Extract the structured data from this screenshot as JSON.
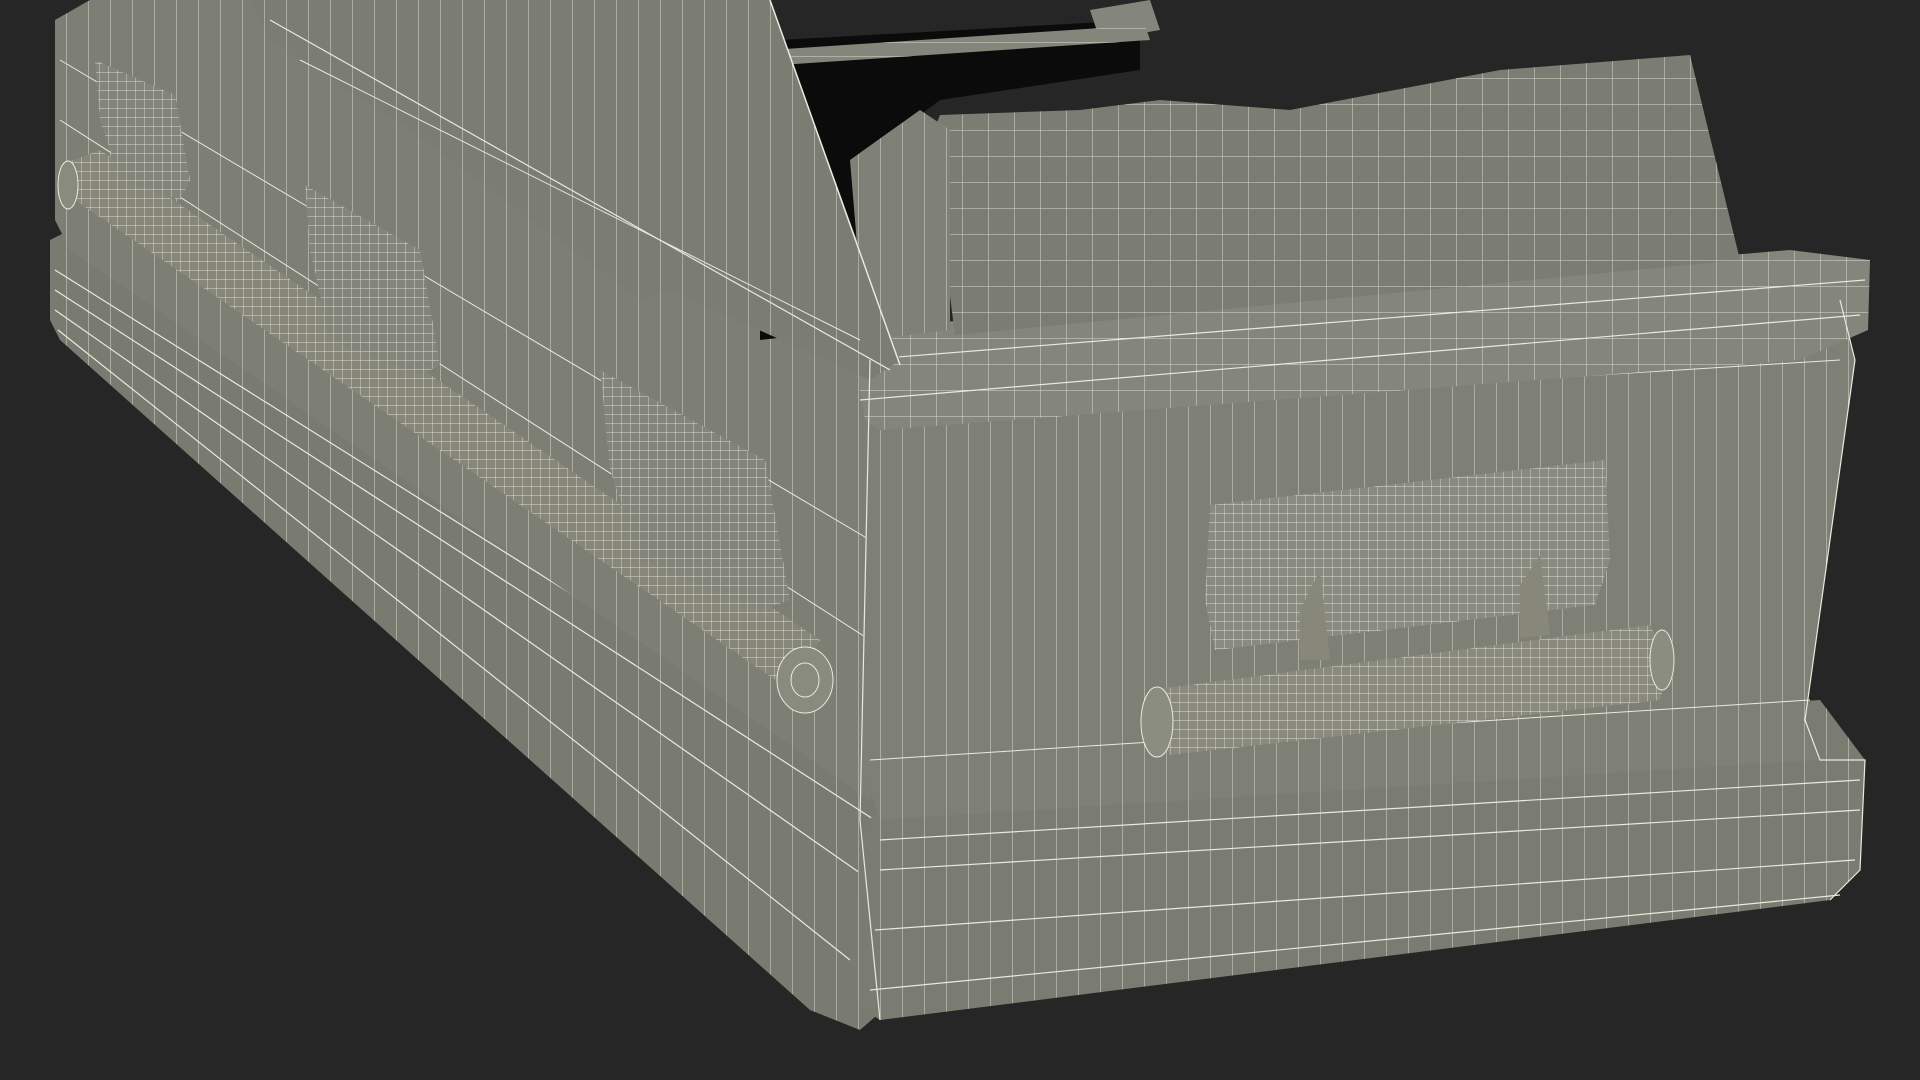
{
  "scene": {
    "subject": "casket-wireframe-render",
    "render_style": "wireframe-over-shaded",
    "colors": {
      "background": "#262626",
      "surface": "#7d7e73",
      "surface_light": "#8a8b80",
      "surface_dark": "#6b6c62",
      "interior": "#0b0b0b",
      "wire": "#e9eadf"
    }
  }
}
